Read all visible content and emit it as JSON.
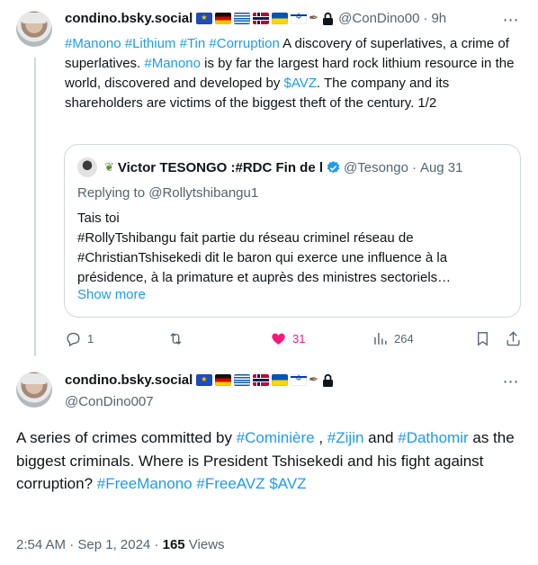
{
  "post1": {
    "display_name": "condino.bsky.social",
    "flags": [
      "eu-flag",
      "germany-flag",
      "greece-flag",
      "norway-flag",
      "ukraine-flag",
      "israel-flag"
    ],
    "handle": "@ConDino00",
    "time": "9h",
    "text": {
      "tag1": "#Manono",
      "tag2": "#Lithium",
      "tag3": "#Tin",
      "tag4": "#Corruption",
      "t1": " A discovery of superlatives, a crime of superlatives. ",
      "tag5": "#Manono",
      "t2": " is by far the largest hard rock lithium resource in the world, discovered and developed by ",
      "cash1": "$AVZ",
      "t3": ". The company and its shareholders are victims of the biggest theft of the century.  1/2"
    },
    "quote": {
      "display_name": "Victor TESONGO :#RDC Fin de l",
      "handle": "@Tesongo",
      "time": "Aug 31",
      "replying_prefix": "Replying to ",
      "replying_to": "@Rollytshibangu1",
      "line1": "Tais toi",
      "line2": "#RollyTshibangu fait partie du réseau criminel réseau de #ChristianTshisekedi dit le baron qui exerce une influence à la présidence, à la primature et auprès des ministres sectoriels…",
      "show_more": "Show more"
    },
    "actions": {
      "replies": "1",
      "reposts": "",
      "likes": "31",
      "views": "264"
    }
  },
  "post2": {
    "display_name": "condino.bsky.social",
    "handle": "@ConDino007",
    "text": {
      "t1": "A series of crimes committed by ",
      "tag1": "#Cominière",
      "t2": " , ",
      "tag2": "#Zijin",
      "t3": " and ",
      "tag3": "#Dathomir",
      "t4": " as the biggest criminals. Where is President Tshisekedi and his fight against corruption? ",
      "tag4": "#FreeManono",
      "t5": " ",
      "tag5": "#FreeAVZ",
      "t6": " ",
      "cash1": "$AVZ"
    },
    "timestamp": "2:54 AM · Sep 1, 2024 · ",
    "views_count": "165",
    "views_label": " Views"
  },
  "colors": {
    "accent": "#1d9bf0",
    "like": "#f91880",
    "muted": "#536471",
    "border": "#cfd9de"
  }
}
